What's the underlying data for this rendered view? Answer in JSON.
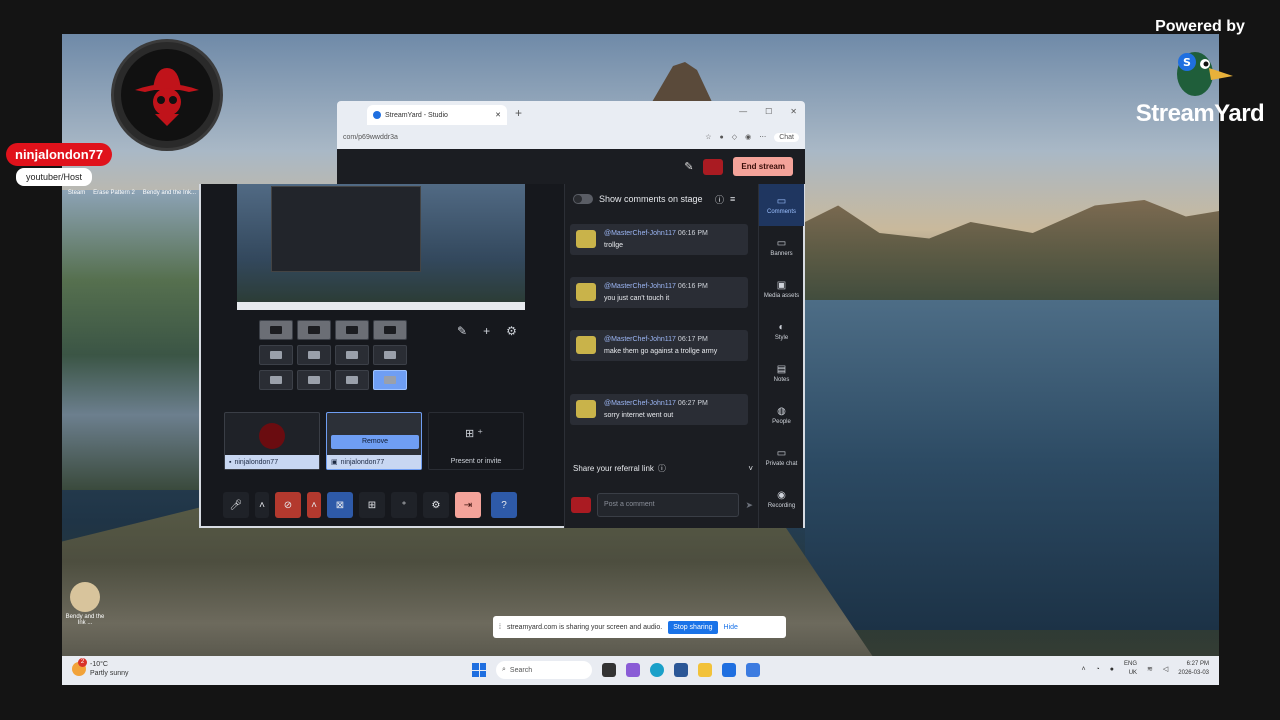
{
  "overlay": {
    "host_name": "ninjalondon77",
    "host_role": "youtuber/Host",
    "powered_by": "Powered by",
    "brand_name": "StreamYard"
  },
  "desktop": {
    "top_icons": [
      "Steam",
      "Erase Pattern 2",
      "Bendy and the Ink..."
    ],
    "bottom_icon": "Bendy and the Ink ..."
  },
  "browser": {
    "tab_title": "StreamYard - Studio",
    "url": "com/p69wwddr3a",
    "chat_label": "Chat"
  },
  "studio": {
    "end_stream_label": "End stream",
    "show_comments_label": "Show comments on stage",
    "remove_label": "Remove",
    "present_invite_label": "Present or invite",
    "tiles": [
      {
        "name": "ninjalondon77"
      },
      {
        "name": "ninjalondon77"
      }
    ],
    "comments": [
      {
        "author": "@MasterChef-John117",
        "time": "06:16 PM",
        "text": "trollge"
      },
      {
        "author": "@MasterChef-John117",
        "time": "06:16 PM",
        "text": "you just can't touch it"
      },
      {
        "author": "@MasterChef-John117",
        "time": "06:17 PM",
        "text": "make them go against a trollge army"
      },
      {
        "author": "@MasterChef-John117",
        "time": "06:27 PM",
        "text": "sorry internet went out"
      }
    ],
    "referral_label": "Share your referral link",
    "post_placeholder": "Post a comment",
    "rail": [
      "Comments",
      "Banners",
      "Media assets",
      "Style",
      "Notes",
      "People",
      "Private chat",
      "Recording"
    ]
  },
  "share_bar": {
    "message": "streamyard.com is sharing your screen and audio.",
    "stop_label": "Stop sharing",
    "hide_label": "Hide"
  },
  "taskbar": {
    "temperature": "-10°C",
    "weather": "Partly sunny",
    "weather_badge": "2",
    "search_label": "Search",
    "lang_top": "ENG",
    "lang_bottom": "UK",
    "time": "6:27 PM",
    "date": "2026-03-03"
  }
}
